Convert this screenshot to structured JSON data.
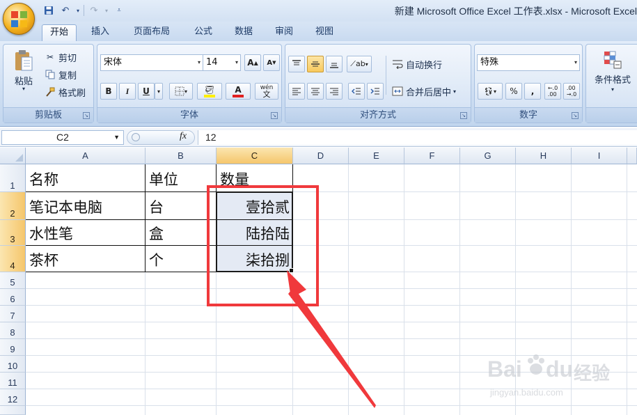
{
  "app": {
    "title": "新建 Microsoft Office Excel 工作表.xlsx - Microsoft Excel"
  },
  "quick_access": {
    "save_icon": "save-icon",
    "undo_icon": "undo-icon",
    "redo_icon": "redo-icon",
    "customize_icon": "customize-icon"
  },
  "tabs": [
    {
      "label": "开始",
      "active": true
    },
    {
      "label": "插入"
    },
    {
      "label": "页面布局"
    },
    {
      "label": "公式"
    },
    {
      "label": "数据"
    },
    {
      "label": "审阅"
    },
    {
      "label": "视图"
    }
  ],
  "ribbon": {
    "clipboard": {
      "label": "剪贴板",
      "paste": "粘贴",
      "cut": "剪切",
      "copy": "复制",
      "format_painter": "格式刷"
    },
    "font": {
      "label": "字体",
      "font_name": "宋体",
      "font_size": "14",
      "bold": "B",
      "italic": "I",
      "underline": "U",
      "font_color_glyph": "A",
      "phonetic_glyph": "wén"
    },
    "alignment": {
      "label": "对齐方式",
      "wrap_text": "自动换行",
      "merge_center": "合并后居中"
    },
    "number": {
      "label": "数字",
      "format": "特殊",
      "percent": "%",
      "comma": ","
    },
    "styles": {
      "conditional_formatting": "条件格式"
    },
    "colors": {
      "fill_color": "#ffef00",
      "font_color": "#e02020",
      "accent": "#f0393c"
    }
  },
  "formula_bar": {
    "name_box": "C2",
    "fx": "fx",
    "value": "12"
  },
  "sheet": {
    "columns": [
      "A",
      "B",
      "C",
      "D",
      "E",
      "F",
      "G",
      "H",
      "I"
    ],
    "selected_column": "C",
    "rows": [
      "1",
      "2",
      "3",
      "4",
      "5",
      "6",
      "7",
      "8",
      "9",
      "10",
      "11",
      "12"
    ],
    "selected_rows": [
      "2",
      "3",
      "4"
    ],
    "cells": {
      "A1": "名称",
      "B1": "单位",
      "C1": "数量",
      "A2": "笔记本电脑",
      "B2": "台",
      "C2": "壹拾贰",
      "A3": "水性笔",
      "B3": "盒",
      "C3": "陆拾陆",
      "A4": "茶杯",
      "B4": "个",
      "C4": "柒拾捌"
    }
  },
  "watermark": {
    "brand": "Bai",
    "brand_suffix": "du",
    "cn": "经验",
    "url": "jingyan.baidu.com"
  }
}
